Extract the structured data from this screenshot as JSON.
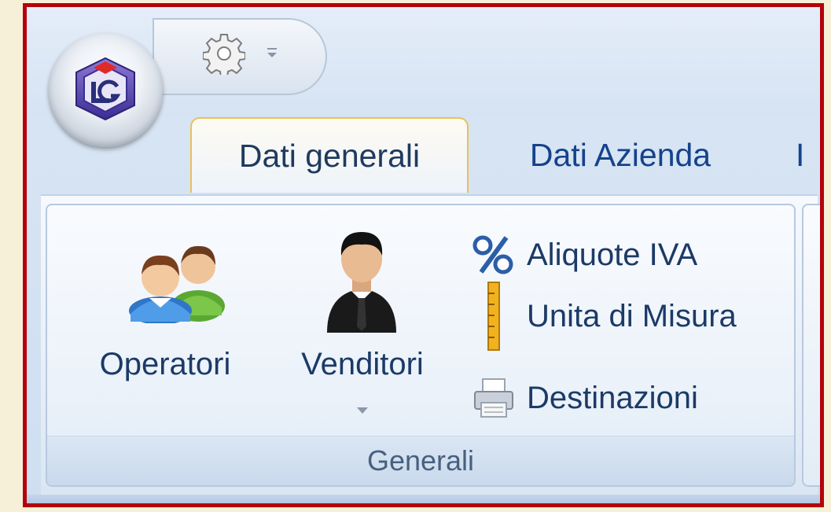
{
  "tabs": [
    {
      "label": "Dati generali",
      "active": true
    },
    {
      "label": "Dati Azienda",
      "active": false
    },
    {
      "label": "I",
      "active": false
    }
  ],
  "group": {
    "caption": "Generali",
    "large_buttons": [
      {
        "label": "Operatori",
        "icon": "users-icon"
      },
      {
        "label": "Venditori",
        "icon": "businessman-icon",
        "has_dropdown": true
      }
    ],
    "small_buttons": [
      {
        "label": "Aliquote IVA",
        "icon": "percent-icon"
      },
      {
        "label": "Unita di Misura",
        "icon": "ruler-icon"
      },
      {
        "label": "Destinazioni",
        "icon": "printer-icon"
      }
    ]
  },
  "quick_access": {
    "icons": [
      "gear-icon",
      "dropdown-arrow-icon"
    ]
  },
  "app_button": {
    "icon": "app-logo-icon"
  },
  "colors": {
    "frame_border": "#b4000b",
    "active_tab_border": "#e7c15a",
    "text": "#15428b",
    "page_background": "#f7f0d8"
  }
}
